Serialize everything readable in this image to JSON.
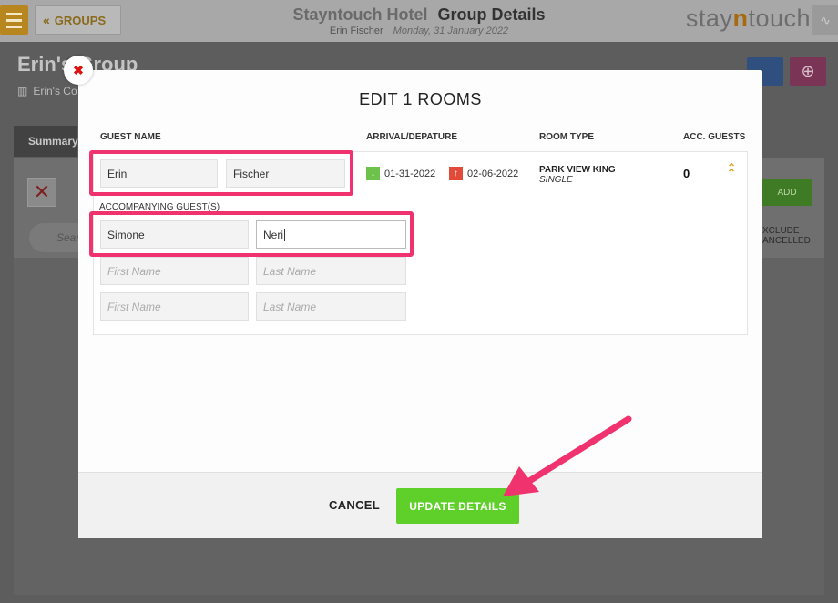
{
  "topbar": {
    "groups_label": "GROUPS",
    "hotel_name": "Stayntouch Hotel",
    "page_name": "Group Details",
    "user": "Erin Fischer",
    "date": "Monday, 31 January 2022",
    "logo_pre": "stay",
    "logo_n": "n",
    "logo_post": "touch"
  },
  "background": {
    "group_title": "Erin's Group",
    "group_sub": "Erin's Co",
    "summary_tab": "Summary",
    "search_placeholder": "Sear",
    "add_label": "ADD",
    "exclude_line1": "XCLUDE",
    "exclude_line2": "ANCELLED"
  },
  "modal": {
    "title": "EDIT 1 ROOMS",
    "columns": {
      "guest_name": "GUEST NAME",
      "arrival": "ARRIVAL/DEPATURE",
      "room_type": "ROOM TYPE",
      "acc_guests": "ACC. GUESTS"
    },
    "guest": {
      "first": "Erin",
      "last": "Fischer"
    },
    "accompanying_label": "ACCOMPANYING GUEST(S)",
    "accompanying": [
      {
        "first": "Simone",
        "last": "Neri"
      },
      {
        "first": "",
        "last": ""
      },
      {
        "first": "",
        "last": ""
      }
    ],
    "placeholders": {
      "first": "First Name",
      "last": "Last Name"
    },
    "arrival_date": "01-31-2022",
    "departure_date": "02-06-2022",
    "room_type": "PARK VIEW KING",
    "room_subtype": "SINGLE",
    "acc_guest_count": "0",
    "cancel_label": "CANCEL",
    "update_label": "UPDATE DETAILS"
  },
  "colors": {
    "accent_green": "#5fcf2a",
    "highlight": "#f0326e",
    "arrival_green": "#6cc24a",
    "departure_red": "#e24a3a"
  }
}
